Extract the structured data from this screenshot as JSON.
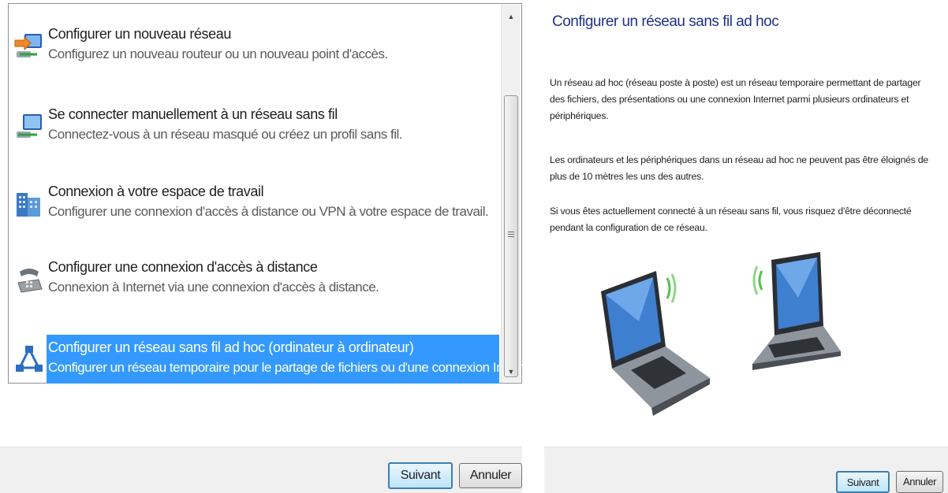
{
  "left": {
    "items": [
      {
        "title": "Configurer un nouveau réseau",
        "desc": "Configurez un nouveau routeur ou un nouveau point d'accès.",
        "icon": "network-setup-icon"
      },
      {
        "title": "Se connecter manuellement à un réseau sans fil",
        "desc": "Connectez-vous à un réseau masqué ou créez un profil sans fil.",
        "icon": "wireless-connect-icon"
      },
      {
        "title": "Connexion à votre espace de travail",
        "desc": "Configurer une connexion d'accès à distance ou VPN à votre espace de travail.",
        "icon": "workplace-building-icon"
      },
      {
        "title": "Configurer une connexion d'accès à distance",
        "desc": "Connexion à Internet via une connexion d'accès à distance.",
        "icon": "dialup-phone-icon"
      },
      {
        "title": "Configurer un réseau sans fil ad hoc (ordinateur à ordinateur)",
        "desc": "Configurer un réseau temporaire pour le partage de fichiers ou d'une connexion Internet.",
        "icon": "adhoc-network-icon",
        "selected": true
      }
    ],
    "buttons": {
      "next": "Suivant",
      "cancel": "Annuler"
    }
  },
  "right": {
    "title": "Configurer un réseau sans fil ad hoc",
    "paragraphs": [
      "Un réseau ad hoc (réseau poste à poste) est un réseau temporaire permettant de partager des fichiers, des présentations ou une connexion Internet parmi plusieurs ordinateurs et périphériques.",
      "Les ordinateurs et les périphériques dans un réseau ad hoc ne peuvent pas être éloignés de plus de 10 mètres les uns des autres.",
      "Si vous êtes actuellement connecté à un réseau sans fil, vous risquez d'être déconnecté pendant la configuration de ce réseau."
    ],
    "illustration": "two-wireless-laptops",
    "buttons": {
      "next": "Suivant",
      "cancel": "Annuler"
    }
  },
  "colors": {
    "selection": "#3399ff",
    "title_blue": "#1e3287",
    "footer_bg": "#f0f0f0",
    "default_button_border": "#3c7fb1"
  }
}
